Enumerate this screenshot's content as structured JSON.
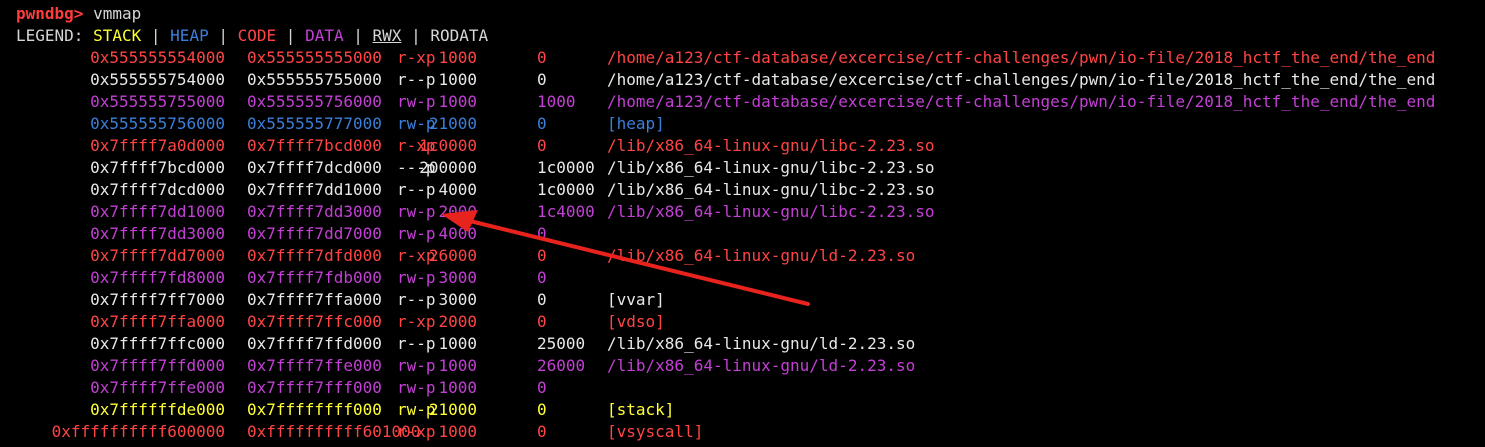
{
  "prompt": {
    "label": "pwndbg>",
    "command": "vmmap"
  },
  "legend": {
    "label": "LEGEND:",
    "items": [
      "STACK",
      "HEAP",
      "CODE",
      "DATA",
      "RWX",
      "RODATA"
    ],
    "separator": "|"
  },
  "colors": {
    "stack": "#ffff33",
    "heap": "#3a7fd9",
    "code": "#ff4444",
    "data": "#c43fd6",
    "rodata": "#e8e8e8",
    "arrow": "#e8221c"
  },
  "rows": [
    {
      "type": "code",
      "start": "0x555555554000",
      "end": "0x555555555000",
      "perm": "r-xp",
      "size": "1000",
      "offset": "0",
      "name": "/home/a123/ctf-database/excercise/ctf-challenges/pwn/io-file/2018_hctf_the_end/the_end"
    },
    {
      "type": "rodata",
      "start": "0x555555754000",
      "end": "0x555555755000",
      "perm": "r--p",
      "size": "1000",
      "offset": "0",
      "name": "/home/a123/ctf-database/excercise/ctf-challenges/pwn/io-file/2018_hctf_the_end/the_end"
    },
    {
      "type": "data",
      "start": "0x555555755000",
      "end": "0x555555756000",
      "perm": "rw-p",
      "size": "1000",
      "offset": "1000",
      "name": "/home/a123/ctf-database/excercise/ctf-challenges/pwn/io-file/2018_hctf_the_end/the_end"
    },
    {
      "type": "heap",
      "start": "0x555555756000",
      "end": "0x555555777000",
      "perm": "rw-p",
      "size": "21000",
      "offset": "0",
      "name": "[heap]"
    },
    {
      "type": "code",
      "start": "0x7ffff7a0d000",
      "end": "0x7ffff7bcd000",
      "perm": "r-xp",
      "size": "1c0000",
      "offset": "0",
      "name": "/lib/x86_64-linux-gnu/libc-2.23.so"
    },
    {
      "type": "rodata",
      "start": "0x7ffff7bcd000",
      "end": "0x7ffff7dcd000",
      "perm": "---p",
      "size": "200000",
      "offset": "1c0000",
      "name": "/lib/x86_64-linux-gnu/libc-2.23.so"
    },
    {
      "type": "rodata",
      "start": "0x7ffff7dcd000",
      "end": "0x7ffff7dd1000",
      "perm": "r--p",
      "size": "4000",
      "offset": "1c0000",
      "name": "/lib/x86_64-linux-gnu/libc-2.23.so"
    },
    {
      "type": "data",
      "start": "0x7ffff7dd1000",
      "end": "0x7ffff7dd3000",
      "perm": "rw-p",
      "size": "2000",
      "offset": "1c4000",
      "name": "/lib/x86_64-linux-gnu/libc-2.23.so"
    },
    {
      "type": "data",
      "start": "0x7ffff7dd3000",
      "end": "0x7ffff7dd7000",
      "perm": "rw-p",
      "size": "4000",
      "offset": "0",
      "name": ""
    },
    {
      "type": "code",
      "start": "0x7ffff7dd7000",
      "end": "0x7ffff7dfd000",
      "perm": "r-xp",
      "size": "26000",
      "offset": "0",
      "name": "/lib/x86_64-linux-gnu/ld-2.23.so"
    },
    {
      "type": "data",
      "start": "0x7ffff7fd8000",
      "end": "0x7ffff7fdb000",
      "perm": "rw-p",
      "size": "3000",
      "offset": "0",
      "name": ""
    },
    {
      "type": "rodata",
      "start": "0x7ffff7ff7000",
      "end": "0x7ffff7ffa000",
      "perm": "r--p",
      "size": "3000",
      "offset": "0",
      "name": "[vvar]"
    },
    {
      "type": "code",
      "start": "0x7ffff7ffa000",
      "end": "0x7ffff7ffc000",
      "perm": "r-xp",
      "size": "2000",
      "offset": "0",
      "name": "[vdso]"
    },
    {
      "type": "rodata",
      "start": "0x7ffff7ffc000",
      "end": "0x7ffff7ffd000",
      "perm": "r--p",
      "size": "1000",
      "offset": "25000",
      "name": "/lib/x86_64-linux-gnu/ld-2.23.so"
    },
    {
      "type": "data",
      "start": "0x7ffff7ffd000",
      "end": "0x7ffff7ffe000",
      "perm": "rw-p",
      "size": "1000",
      "offset": "26000",
      "name": "/lib/x86_64-linux-gnu/ld-2.23.so"
    },
    {
      "type": "data",
      "start": "0x7ffff7ffe000",
      "end": "0x7ffff7fff000",
      "perm": "rw-p",
      "size": "1000",
      "offset": "0",
      "name": ""
    },
    {
      "type": "stack",
      "start": "0x7ffffffde000",
      "end": "0x7ffffffff000",
      "perm": "rw-p",
      "size": "21000",
      "offset": "0",
      "name": "[stack]"
    },
    {
      "type": "code",
      "start": "0xffffffffff600000",
      "end": "0xffffffffff601000",
      "perm": "r-xp",
      "size": "1000",
      "offset": "0",
      "name": "[vsyscall]"
    }
  ]
}
